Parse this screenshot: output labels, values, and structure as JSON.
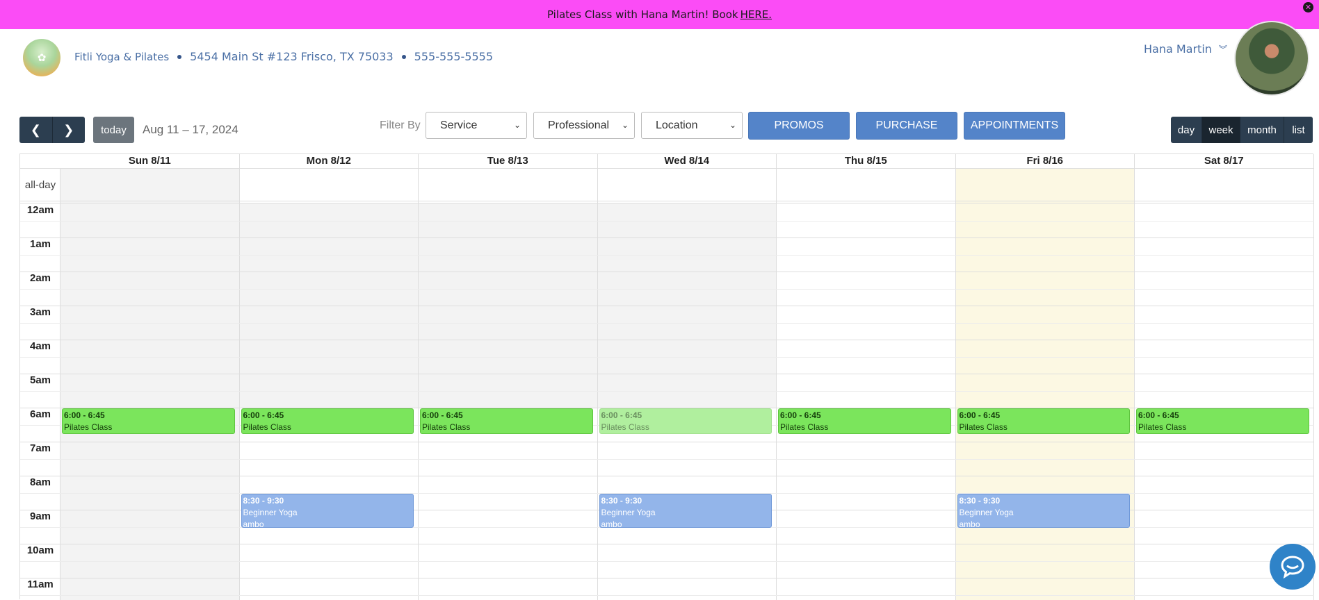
{
  "banner": {
    "text": "Pilates Class with Hana Martin! Book",
    "link": "HERE."
  },
  "business": {
    "name": "Fitli Yoga & Pilates",
    "address": "5454 Main St #123 Frisco, TX 75033",
    "phone": "555-555-5555"
  },
  "user": {
    "name": "Hana Martin"
  },
  "toolbar": {
    "today": "today",
    "date_range": "Aug 11 – 17, 2024",
    "filter_label": "Filter By",
    "filters": [
      "Service",
      "Professional",
      "Location"
    ],
    "buttons": [
      "PROMOS",
      "PURCHASE",
      "APPOINTMENTS"
    ],
    "views": [
      "day",
      "week",
      "month",
      "list"
    ],
    "active_view": "week"
  },
  "calendar": {
    "allday_label": "all-day",
    "days": [
      "Sun 8/11",
      "Mon 8/12",
      "Tue 8/13",
      "Wed 8/14",
      "Thu 8/15",
      "Fri 8/16",
      "Sat 8/17"
    ],
    "hours": [
      "12am",
      "1am",
      "2am",
      "3am",
      "4am",
      "5am",
      "6am",
      "7am",
      "8am",
      "9am",
      "10am",
      "11am"
    ],
    "events": [
      {
        "day": 0,
        "time": "6:00 - 6:45",
        "title": "Pilates Class",
        "sub": "",
        "kind": "green"
      },
      {
        "day": 1,
        "time": "6:00 - 6:45",
        "title": "Pilates Class",
        "sub": "",
        "kind": "green"
      },
      {
        "day": 2,
        "time": "6:00 - 6:45",
        "title": "Pilates Class",
        "sub": "",
        "kind": "green"
      },
      {
        "day": 3,
        "time": "6:00 - 6:45",
        "title": "Pilates Class",
        "sub": "",
        "kind": "green-faded"
      },
      {
        "day": 4,
        "time": "6:00 - 6:45",
        "title": "Pilates Class",
        "sub": "",
        "kind": "green"
      },
      {
        "day": 5,
        "time": "6:00 - 6:45",
        "title": "Pilates Class",
        "sub": "",
        "kind": "green"
      },
      {
        "day": 6,
        "time": "6:00 - 6:45",
        "title": "Pilates Class",
        "sub": "",
        "kind": "green"
      },
      {
        "day": 1,
        "time": "8:30 - 9:30",
        "title": "Beginner Yoga",
        "sub": "ambo",
        "kind": "blue"
      },
      {
        "day": 3,
        "time": "8:30 - 9:30",
        "title": "Beginner Yoga",
        "sub": "ambo",
        "kind": "blue"
      },
      {
        "day": 5,
        "time": "8:30 - 9:30",
        "title": "Beginner Yoga",
        "sub": "ambo",
        "kind": "blue"
      }
    ]
  }
}
